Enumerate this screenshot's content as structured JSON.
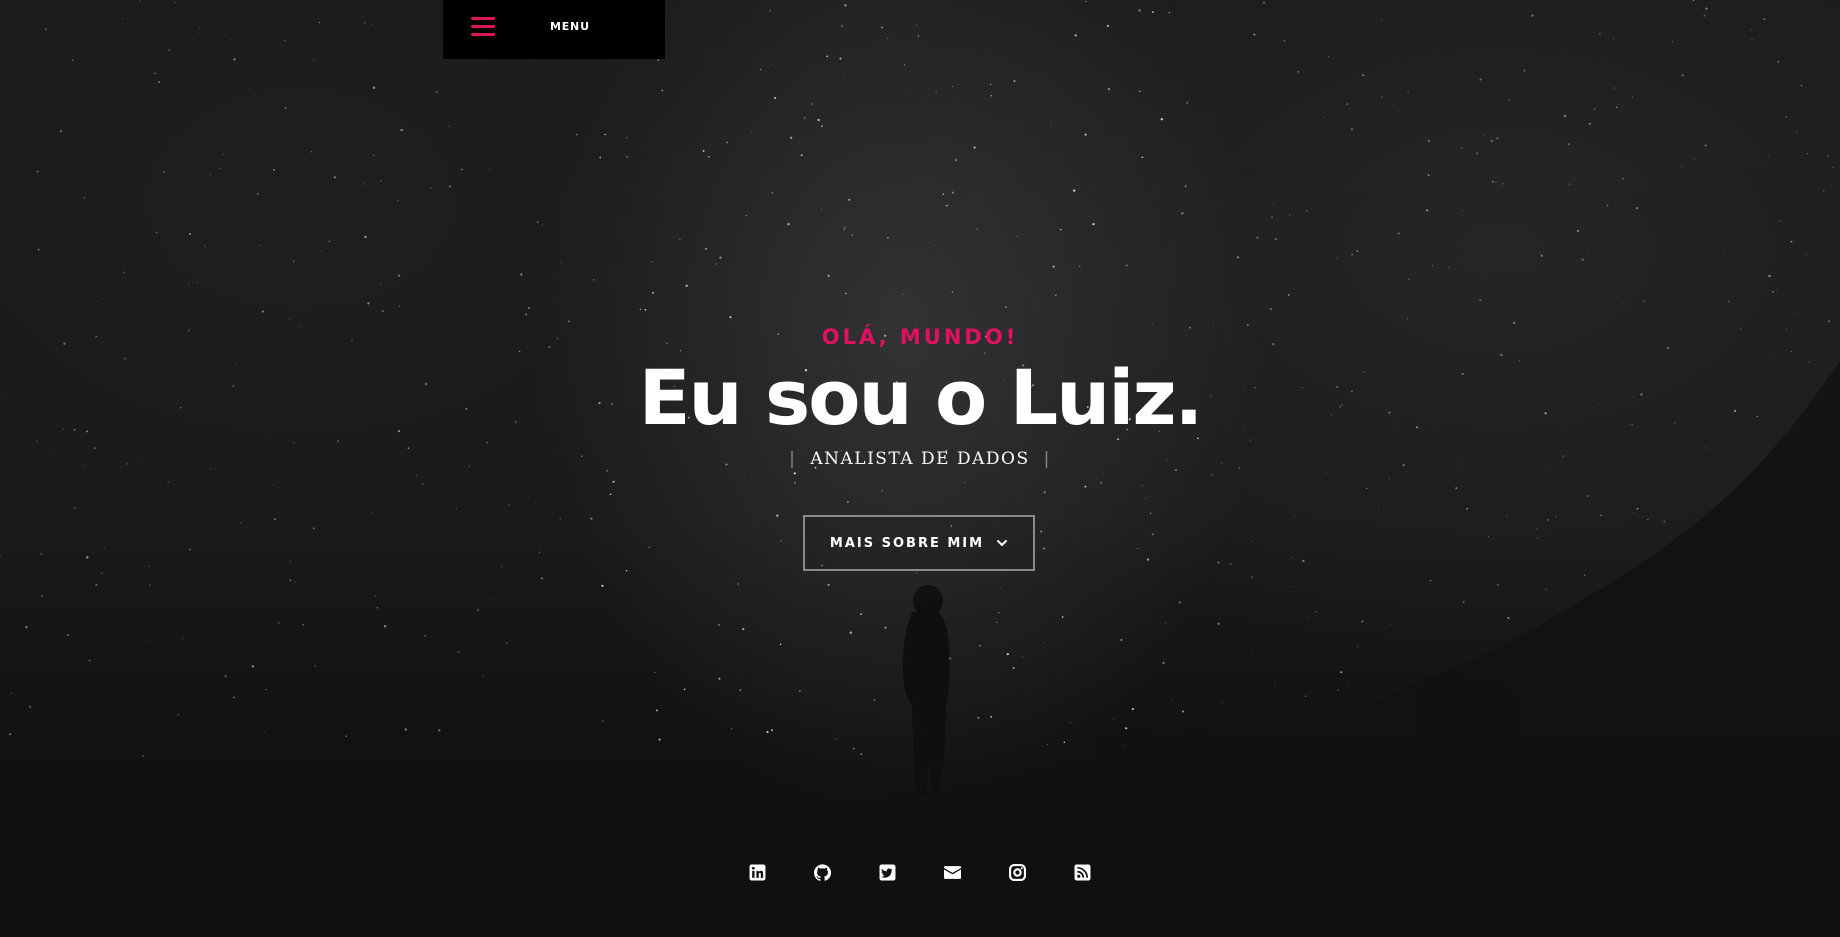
{
  "menu": {
    "label": "MENU",
    "icon": "hamburger-icon"
  },
  "intro": {
    "greeting": "OLÁ, MUNDO!",
    "headline": "Eu sou o Luiz.",
    "role": "ANALISTA DE DADOS",
    "role_divider": "|",
    "cta_label": "MAIS SOBRE MIM",
    "cta_icon": "chevron-down-icon"
  },
  "social": [
    {
      "name": "linkedin",
      "icon": "linkedin-icon"
    },
    {
      "name": "github",
      "icon": "github-icon"
    },
    {
      "name": "twitter",
      "icon": "twitter-icon"
    },
    {
      "name": "email",
      "icon": "envelope-icon"
    },
    {
      "name": "instagram",
      "icon": "instagram-icon"
    },
    {
      "name": "rss",
      "icon": "rss-icon"
    }
  ],
  "colors": {
    "accent": "#e0115f",
    "background": "#101011",
    "text": "#ffffff",
    "button_border": "#8a8a8a"
  }
}
